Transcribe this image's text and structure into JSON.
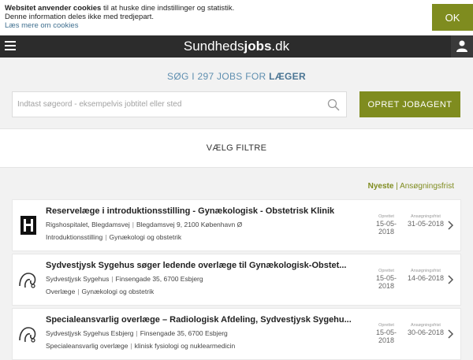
{
  "cookie": {
    "bold": "Websitet anvender cookies",
    "text1": " til at huske dine indstillinger og statistik.",
    "text2": "Denne information deles ikke med tredjepart.",
    "link": "Læs mere om cookies",
    "ok": "OK"
  },
  "header": {
    "logo_regular": "Sundheds",
    "logo_bold": "jobs",
    "logo_tld": ".dk"
  },
  "search": {
    "heading_prefix": "SØG I 297 JOBS FOR ",
    "heading_bold": "LÆGER",
    "placeholder": "Indtast søgeord - eksempelvis jobtitel eller sted",
    "button": "OPRET JOBAGENT"
  },
  "filter": {
    "label": "VÆLG FILTRE"
  },
  "sort": {
    "newest": "Nyeste",
    "separator": "|",
    "deadline": "Ansøgningsfrist"
  },
  "jobs": [
    {
      "title": "Reservelæge i introduktionsstilling - Gynækologisk - Obstetrisk Klinik",
      "employer": "Rigshospitalet, Blegdamsvej",
      "address": "Blegdamsvej 9, 2100 København Ø",
      "tag1": "Introduktionsstilling",
      "tag2": "Gynækologi og obstetrik",
      "posted_label": "Oprettet",
      "posted": "15-05-2018",
      "deadline_label": "Ansøgningsfrist",
      "deadline": "31-05-2018",
      "logo": "rigshospitalet-logo"
    },
    {
      "title": "Sydvestjysk Sygehus søger ledende overlæge til Gynækologisk-Obstet...",
      "employer": "Sydvestjysk Sygehus",
      "address": "Finsengade 35, 6700 Esbjerg",
      "tag1": "Overlæge",
      "tag2": "Gynækologi og obstetrik",
      "posted_label": "Oprettet",
      "posted": "15-05-2018",
      "deadline_label": "Ansøgningsfrist",
      "deadline": "14-06-2018",
      "logo": "region-syddanmark-logo"
    },
    {
      "title": "Specialeansvarlig overlæge – Radiologisk Afdeling, Sydvestjysk Sygehu...",
      "employer": "Sydvestjysk Sygehus Esbjerg",
      "address": "Finsengade 35, 6700 Esbjerg",
      "tag1": "Specialeansvarlig overlæge",
      "tag2": "klinisk fysiologi og nuklearmedicin",
      "posted_label": "Oprettet",
      "posted": "15-05-2018",
      "deadline_label": "Ansøgningsfrist",
      "deadline": "30-06-2018",
      "logo": "region-syddanmark-logo"
    }
  ],
  "colors": {
    "accent": "#7f8c1f",
    "header": "#2c2c2c",
    "heading": "#5f8fb0"
  }
}
